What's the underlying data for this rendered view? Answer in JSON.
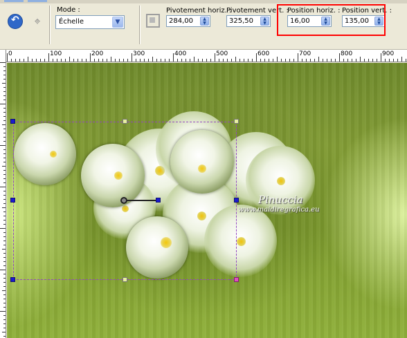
{
  "toolbar": {
    "mode_label": "Mode :",
    "mode_value": "Échelle",
    "pivot_h_label": "Pivotement horiz. :",
    "pivot_h_value": "284,00",
    "pivot_v_label": "Pivotement vert. :",
    "pivot_v_value": "325,50",
    "pos_h_label": "Position horiz. :",
    "pos_h_value": "16,00",
    "pos_v_label": "Position vert. :",
    "pos_v_value": "135,00",
    "highlight_color": "#ff0000",
    "accent_color": "#2f67c8"
  },
  "ruler": {
    "labels": [
      "0",
      "100",
      "200",
      "300",
      "400",
      "500",
      "600",
      "700",
      "800",
      "900"
    ]
  },
  "canvas": {
    "watermark_title": "Pinuccia",
    "watermark_url": "www.maidiregrafica.eu",
    "background_color": "#7d9a2e",
    "selection_color": "#3a3adb"
  },
  "icons": [
    "reset-icon",
    "pick-tool-icon",
    "chevron-down-icon",
    "frame-icon",
    "spin-arrows-icon"
  ]
}
